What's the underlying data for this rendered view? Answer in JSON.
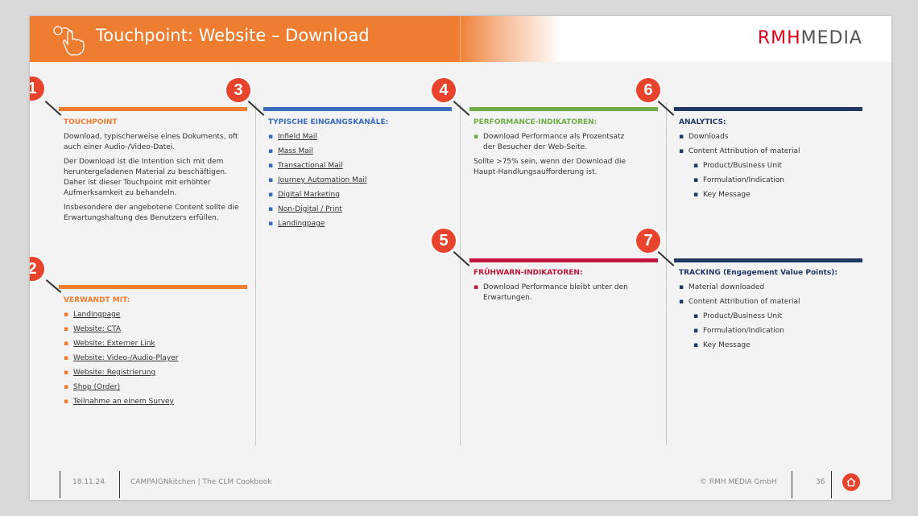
{
  "header": {
    "title": "Touchpoint: Website – Download",
    "logo_part1": "RMH",
    "logo_part2": "MEDIA"
  },
  "colors": {
    "orange": "#ef7d31",
    "blue": "#3a6bbf",
    "green": "#70ad47",
    "red": "#c0143c",
    "navy": "#1f3864",
    "badge": "#e8432d"
  },
  "badges": [
    "1",
    "2",
    "3",
    "4",
    "5",
    "6",
    "7"
  ],
  "touchpoint": {
    "heading": "TOUCHPOINT",
    "paragraphs": [
      "Download, typischerweise eines Dokuments, oft auch einer Audio-/Video-Datei.",
      "Der Download ist die Intention sich mit dem heruntergeladenen Material zu beschäftigen. Daher ist dieser Touchpoint mit erhöhter Aufmerksamkeit zu behandeln.",
      "Insbesondere der angebotene Content sollte die Erwartungshaltung des Benutzers erfüllen."
    ]
  },
  "verwandt": {
    "heading": "VERWANDT MIT:",
    "items": [
      "Landingpage",
      "Website: CTA",
      "Website: Externer Link",
      "Website: Video-/Audio-Player",
      "Website: Registrierung",
      "Shop (Order)",
      "Teilnahme an einem Survey"
    ]
  },
  "kanaele": {
    "heading": "TYPISCHE EINGANGSKANÄLE:",
    "items": [
      "Infield Mail",
      "Mass Mail",
      "Transactional Mail",
      "Journey Automation Mail",
      "Digital Marketing",
      "Non-Digital / Print",
      "Landingpage"
    ]
  },
  "performance": {
    "heading": "PERFORMANCE-INDIKATOREN:",
    "items": [
      "Download Performance als Prozentsatz der Besucher der Web-Seite."
    ],
    "paragraph": "Sollte >75% sein, wenn der Download die Haupt-Handlungsaufforderung ist."
  },
  "fruehwarn": {
    "heading": "FRÜHWARN-INDIKATOREN:",
    "items": [
      "Download Performance bleibt unter den Erwartungen."
    ]
  },
  "analytics": {
    "heading": "ANALYTICS:",
    "items": [
      "Downloads",
      "Content Attribution of material"
    ],
    "subitems": [
      "Product/Business Unit",
      "Formulation/Indication",
      "Key Message"
    ]
  },
  "tracking": {
    "heading": "TRACKING (Engagement Value Points):",
    "items": [
      "Material downloaded",
      "Content Attribution of material"
    ],
    "subitems": [
      "Product/Business Unit",
      "Formulation/Indication",
      "Key Message"
    ]
  },
  "footer": {
    "date": "18.11.24",
    "title": "CAMPAIGNkitchen | The CLM Cookbook",
    "copyright": "© RMH MEDIA GmbH",
    "page": "36"
  },
  "icons": {
    "header": "hand-tap-icon",
    "home": "home-icon"
  }
}
